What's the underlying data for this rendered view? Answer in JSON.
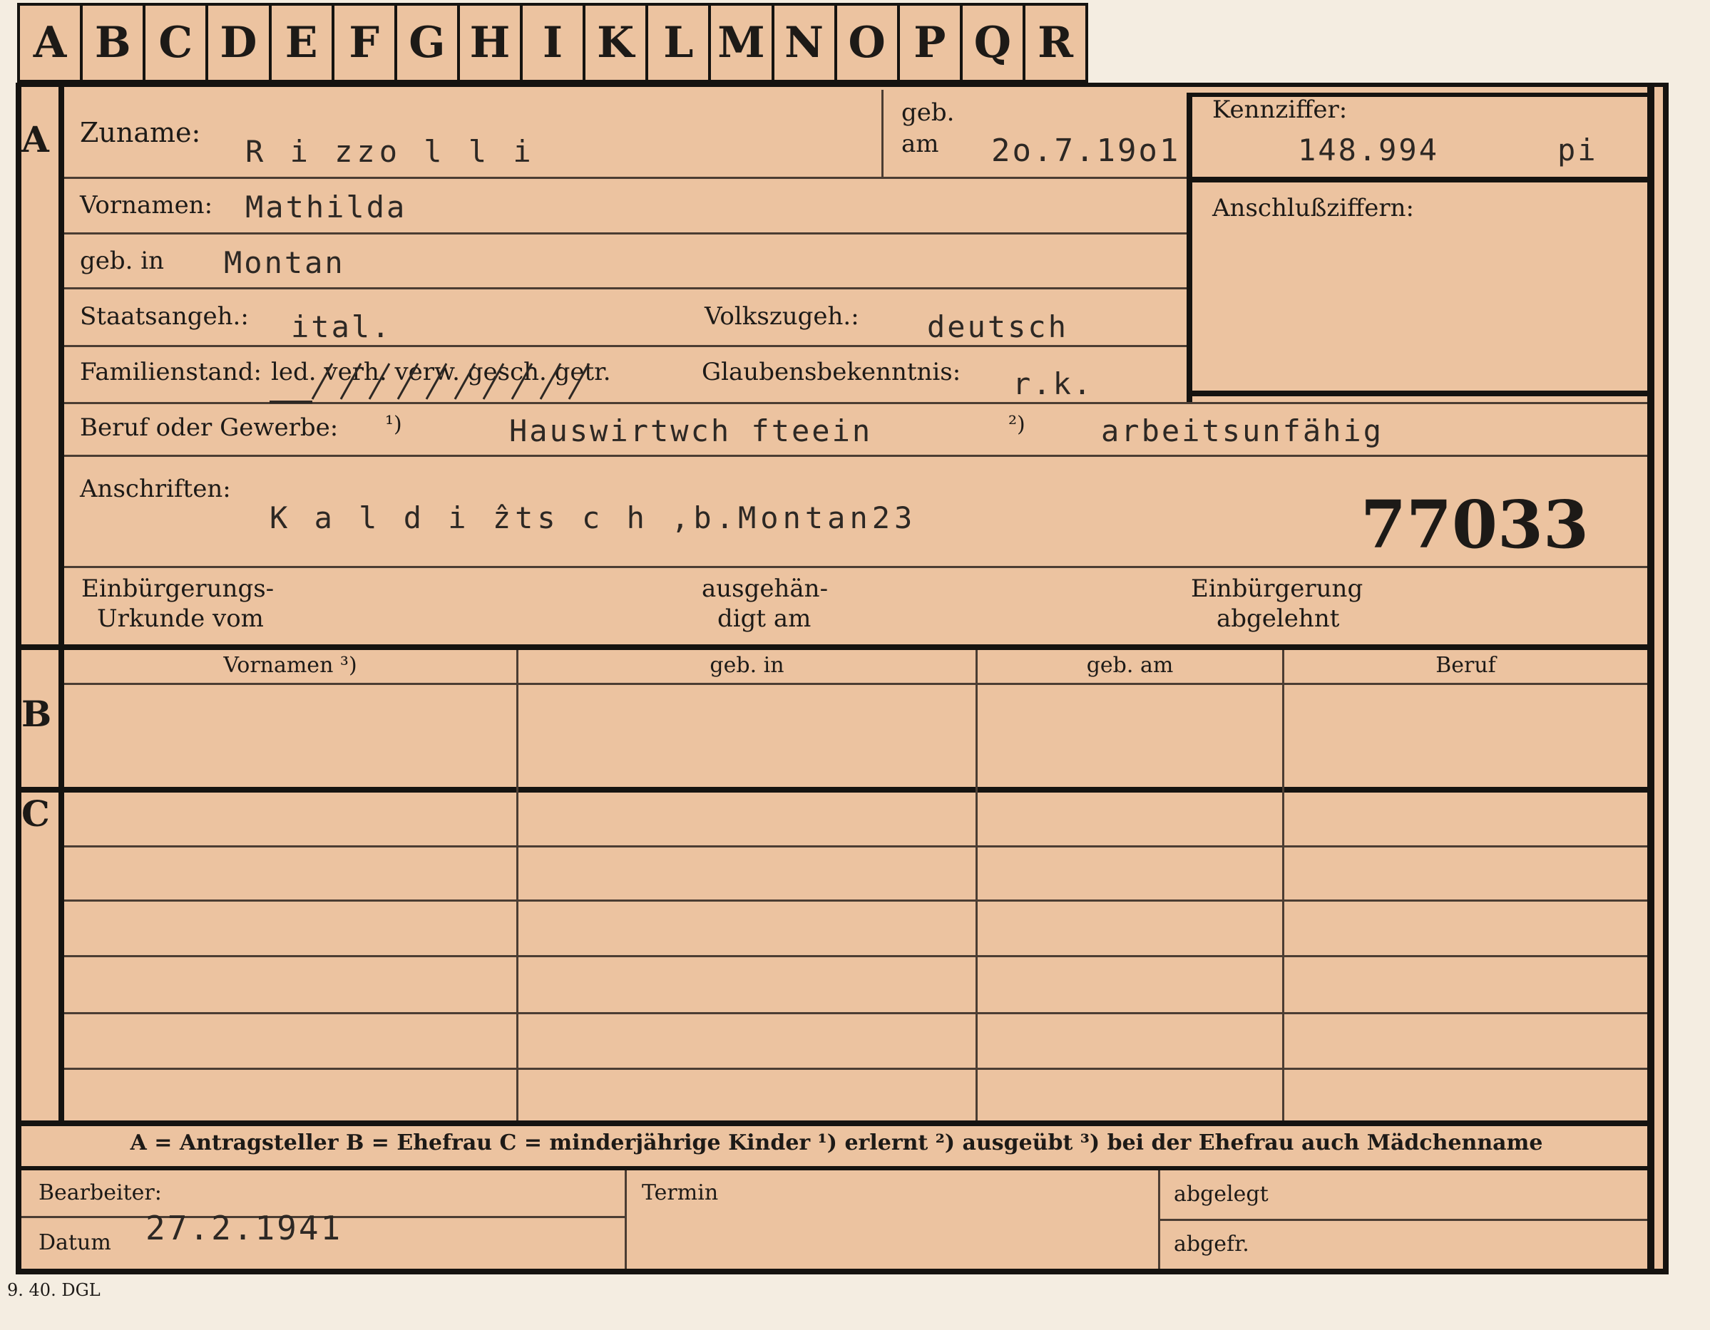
{
  "alphabet_tabs": [
    "A",
    "B",
    "C",
    "D",
    "E",
    "F",
    "G",
    "H",
    "I",
    "K",
    "L",
    "M",
    "N",
    "O",
    "P",
    "Q",
    "R"
  ],
  "section_letters": {
    "a": "A",
    "b": "B",
    "c": "C"
  },
  "labels": {
    "zuname": "Zuname:",
    "geb_am_1": "geb.",
    "geb_am_2": "am",
    "kennziffer": "Kennziffer:",
    "anschlussziffern": "Anschlußziffern:",
    "vornamen": "Vornamen:",
    "geb_in": "geb. in",
    "staatsangeh": "Staatsangeh.:",
    "volkszugeh": "Volkszugeh.:",
    "familienstand": "Familienstand:",
    "familienstand_options": "led. verh. verw. gesch. getr.",
    "glaubensbekenntnis": "Glaubensbekenntnis:",
    "beruf": "Beruf oder Gewerbe:",
    "beruf_note1": "¹)",
    "beruf_note2": "²)",
    "anschriften": "Anschriften:",
    "einb_urkunde_1": "Einbürgerungs-",
    "einb_urkunde_2": "Urkunde vom",
    "ausgehaendigt_1": "ausgehän-",
    "ausgehaendigt_2": "digt am",
    "einb_abgelehnt_1": "Einbürgerung",
    "einb_abgelehnt_2": "abgelehnt",
    "legend": "A = Antragsteller    B = Ehefrau    C = minderjährige Kinder    ¹) erlernt    ²) ausgeübt    ³) bei der Ehefrau auch Mädchenname",
    "bearbeiter": "Bearbeiter:",
    "datum": "Datum",
    "termin": "Termin",
    "abgelegt": "abgelegt",
    "abgefr": "abgefr.",
    "print_code": "9. 40. DGL"
  },
  "table_headers": [
    "Vornamen ³)",
    "geb. in",
    "geb. am",
    "Beruf"
  ],
  "values": {
    "zuname": "R i zzo l l i",
    "geb_am": "2o.7.19o1",
    "kennziffer": "148.994",
    "kennziffer_suffix": "pi",
    "vornamen": "Mathilda",
    "geb_in": "Montan",
    "staatsangeh": "ital.",
    "volkszugeh": "deutsch",
    "glaubensbekenntnis": "r.k.",
    "beruf_erlernt": "Hauswirtwch fteein",
    "beruf_ausgeuebt": "arbeitsunfähig",
    "anschrift": "K a l d i ẑts c h ,b.Montan23",
    "stamp_number": "77033",
    "datum": "27.2.1941"
  }
}
